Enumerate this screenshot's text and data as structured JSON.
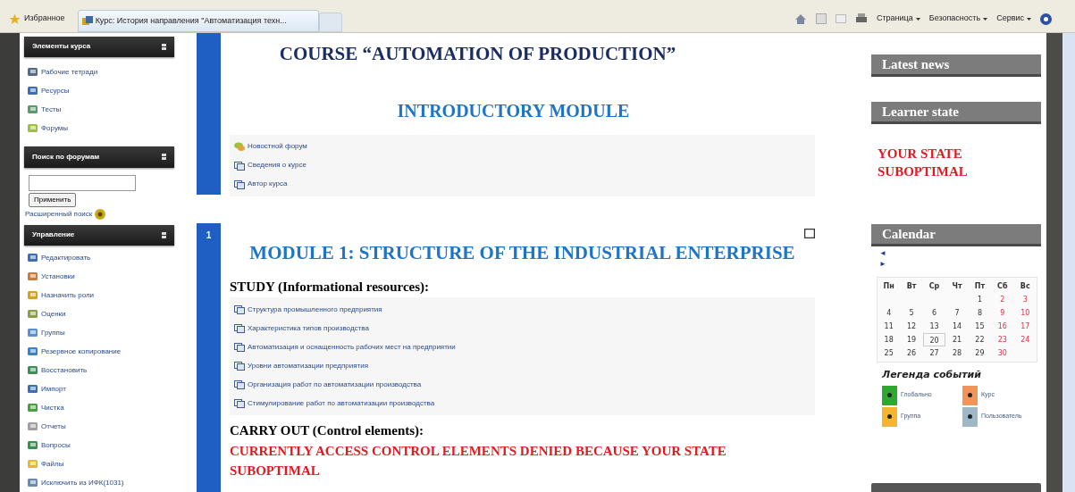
{
  "browser": {
    "favorites": "Избранное",
    "tab_title": "Курс: История направления \"Автоматизация техн...",
    "menus": [
      "Страница",
      "Безопасность",
      "Сервис"
    ]
  },
  "left_sidebar": {
    "course_elements": {
      "title": "Элементы курса",
      "items": [
        "Рабочие тетради",
        "Ресурсы",
        "Тесты",
        "Форумы"
      ]
    },
    "forum_search": {
      "title": "Поиск по форумам",
      "button": "Применить",
      "advanced_link": "Расширенный поиск"
    },
    "administration": {
      "title": "Управление",
      "items": [
        "Редактировать",
        "Установки",
        "Назначить роли",
        "Оценки",
        "Группы",
        "Резервное копирование",
        "Восстановить",
        "Импорт",
        "Чистка",
        "Отчеты",
        "Вопросы",
        "Файлы",
        "Исключить из ИФК(1031)"
      ]
    }
  },
  "sections": [
    {
      "heading": "COURSE “AUTOMATION OF PRODUCTION”",
      "subheading": "INTRODUCTORY MODULE",
      "activities": [
        {
          "kind": "forum",
          "label": "Новостной форум"
        },
        {
          "kind": "resource",
          "label": "Сведения о курсе"
        },
        {
          "kind": "resource",
          "label": "Автор курса"
        }
      ]
    },
    {
      "number": "1",
      "heading": "MODULE 1: STRUCTURE OF THE INDUSTRIAL ENTERPRISE",
      "study_label": "STUDY (Informational resources):",
      "activities": [
        {
          "kind": "resource",
          "label": "Структура промышленного предприятия"
        },
        {
          "kind": "resource",
          "label": "Характеристика типов производства"
        },
        {
          "kind": "resource",
          "label": "Автоматизация и оснащенность рабочих мест на предприятии"
        },
        {
          "kind": "resource",
          "label": "Уровни автоматизации предприятия"
        },
        {
          "kind": "resource",
          "label": "Организация работ по автоматизации производства"
        },
        {
          "kind": "resource",
          "label": "Стимулирование работ по автоматизации производства"
        }
      ],
      "carry_out_label": "CARRY OUT (Control elements):",
      "notice": "CURRENTLY ACCESS CONTROL ELEMENTS DENIED BECAUSE YOUR STATE SUBOPTIMAL"
    }
  ],
  "right_blocks": {
    "latest_news": {
      "title": "Latest news"
    },
    "learner_state": {
      "title": "Learner state",
      "state": "YOUR STATE SUBOPTIMAL"
    },
    "calendar": {
      "title": "Calendar",
      "prev": "◄",
      "next": "►",
      "weekdays": [
        "Пн",
        "Вт",
        "Ср",
        "Чт",
        "Пт",
        "Сб",
        "Вс"
      ],
      "weeks": [
        [
          {
            "kind": "empty"
          },
          {
            "kind": "empty"
          },
          {
            "kind": "empty"
          },
          {
            "kind": "empty"
          },
          {
            "day": "1",
            "weekend": false,
            "today": false
          },
          {
            "day": "2",
            "weekend": true,
            "today": false
          },
          {
            "day": "3",
            "weekend": true,
            "today": false
          }
        ],
        [
          {
            "day": "4",
            "weekend": false,
            "today": false
          },
          {
            "day": "5",
            "weekend": false,
            "today": false
          },
          {
            "day": "6",
            "weekend": false,
            "today": false
          },
          {
            "day": "7",
            "weekend": false,
            "today": false
          },
          {
            "day": "8",
            "weekend": false,
            "today": false
          },
          {
            "day": "9",
            "weekend": true,
            "today": false
          },
          {
            "day": "10",
            "weekend": true,
            "today": false
          }
        ],
        [
          {
            "day": "11",
            "weekend": false,
            "today": false
          },
          {
            "day": "12",
            "weekend": false,
            "today": false
          },
          {
            "day": "13",
            "weekend": false,
            "today": false
          },
          {
            "day": "14",
            "weekend": false,
            "today": false
          },
          {
            "day": "15",
            "weekend": false,
            "today": false
          },
          {
            "day": "16",
            "weekend": true,
            "today": false
          },
          {
            "day": "17",
            "weekend": true,
            "today": false
          }
        ],
        [
          {
            "day": "18",
            "weekend": false,
            "today": false
          },
          {
            "day": "19",
            "weekend": false,
            "today": false
          },
          {
            "day": "20",
            "weekend": false,
            "today": true
          },
          {
            "day": "21",
            "weekend": false,
            "today": false
          },
          {
            "day": "22",
            "weekend": false,
            "today": false
          },
          {
            "day": "23",
            "weekend": true,
            "today": false
          },
          {
            "day": "24",
            "weekend": true,
            "today": false
          }
        ],
        [
          {
            "day": "25",
            "weekend": false,
            "today": false
          },
          {
            "day": "26",
            "weekend": false,
            "today": false
          },
          {
            "day": "27",
            "weekend": false,
            "today": false
          },
          {
            "day": "28",
            "weekend": false,
            "today": false
          },
          {
            "day": "29",
            "weekend": false,
            "today": false
          },
          {
            "day": "30",
            "weekend": true,
            "today": false
          },
          {
            "kind": "empty"
          }
        ]
      ],
      "legend_title": "Легенда событий",
      "legend": [
        {
          "label": "Глобально",
          "color": "#2fa82f"
        },
        {
          "label": "Курс",
          "color": "#f0945a"
        },
        {
          "label": "Группа",
          "color": "#f5b52e"
        },
        {
          "label": "Пользователь",
          "color": "#9fb8c8"
        }
      ]
    }
  }
}
